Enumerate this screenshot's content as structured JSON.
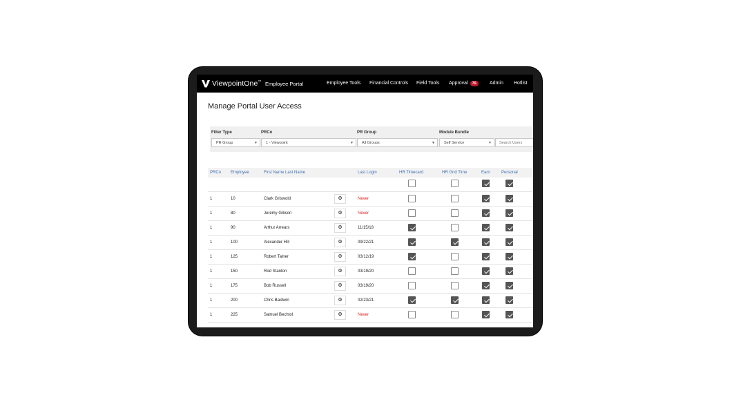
{
  "app": {
    "logo_text": "ViewpointOne",
    "logo_tm": "™",
    "portal_name": "Employee Portal",
    "nav": [
      "Employee Tools",
      "Financial Controls",
      "Field Tools",
      "Approval",
      "Admin",
      "Hotlist"
    ],
    "approval_badge": "76"
  },
  "page": {
    "title": "Manage Portal User Access"
  },
  "filters": {
    "filter_type": {
      "label": "Filter Type",
      "value": "PR Group"
    },
    "prco": {
      "label": "PRCo",
      "value": "1 - Viewpoint"
    },
    "pr_group": {
      "label": "PR Group",
      "value": "All Groups"
    },
    "module_bundle": {
      "label": "Module Bundle",
      "value": "Self Service"
    },
    "search_placeholder": "Search Users"
  },
  "table": {
    "columns": [
      "PRCo",
      "Employee",
      "First Name Last Name",
      "Last Login",
      "HR Timecard",
      "HR Grid Time",
      "Earn",
      "Personal"
    ],
    "header_checks": [
      false,
      false,
      true,
      true
    ],
    "rows": [
      {
        "prco": "1",
        "employee": "10",
        "name": "Clark Griswold",
        "last_login": "Never",
        "never": true,
        "checks": [
          false,
          false,
          true,
          true
        ]
      },
      {
        "prco": "1",
        "employee": "80",
        "name": "Jeremy Gibson",
        "last_login": "Never",
        "never": true,
        "checks": [
          false,
          false,
          true,
          true
        ]
      },
      {
        "prco": "1",
        "employee": "90",
        "name": "Arthur Arrears",
        "last_login": "11/15/18",
        "never": false,
        "checks": [
          true,
          false,
          true,
          true
        ]
      },
      {
        "prco": "1",
        "employee": "100",
        "name": "Alexander Hill",
        "last_login": "09/22/21",
        "never": false,
        "checks": [
          true,
          true,
          true,
          true
        ]
      },
      {
        "prco": "1",
        "employee": "125",
        "name": "Robert Talner",
        "last_login": "03/12/19",
        "never": false,
        "checks": [
          true,
          false,
          true,
          true
        ]
      },
      {
        "prco": "1",
        "employee": "150",
        "name": "Rod Stanton",
        "last_login": "03/19/20",
        "never": false,
        "checks": [
          false,
          false,
          true,
          true
        ]
      },
      {
        "prco": "1",
        "employee": "175",
        "name": "Bob Russell",
        "last_login": "03/19/20",
        "never": false,
        "checks": [
          false,
          false,
          true,
          true
        ]
      },
      {
        "prco": "1",
        "employee": "200",
        "name": "Chris Baldwin",
        "last_login": "02/23/21",
        "never": false,
        "checks": [
          true,
          true,
          true,
          true
        ]
      },
      {
        "prco": "1",
        "employee": "225",
        "name": "Samuel Bechtol",
        "last_login": "Never",
        "never": true,
        "checks": [
          false,
          false,
          true,
          true
        ]
      }
    ]
  },
  "colors": {
    "accent": "#3b6fb0",
    "never": "#e02020",
    "badge": "#c0162b",
    "navbar": "#000000"
  },
  "icons": {
    "settings": "gear-icon",
    "logo": "viewpoint-v-logo"
  }
}
